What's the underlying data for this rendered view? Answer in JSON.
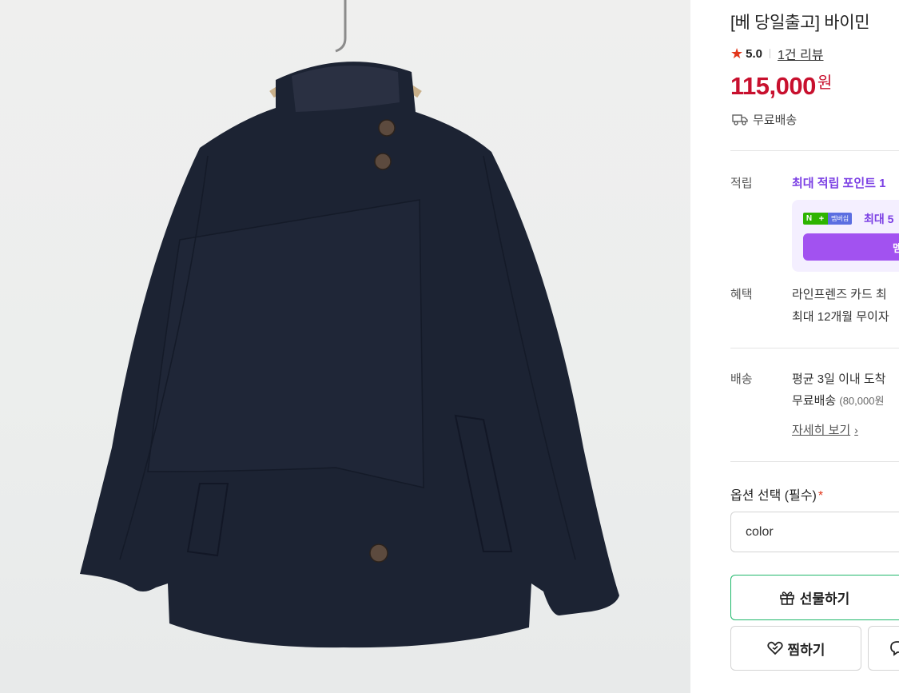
{
  "product": {
    "title": "[베 당일출고] 바이민",
    "rating": "5.0",
    "review_count": "1건 리뷰",
    "price": "115,000",
    "price_unit": "원",
    "shipping_badge": "무료배송",
    "image_alt": "BY MIN"
  },
  "benefits": {
    "points_label": "적립",
    "points_title": "최대 적립 포인트 1",
    "npay_n": "N",
    "npay_plus": "+",
    "npay_membership": "멤버십",
    "points_sub": "최대 5",
    "points_button": "멤버",
    "benefit_label": "혜택",
    "benefit_line1": "라인프렌즈 카드 최",
    "benefit_line2": "최대 12개월 무이자"
  },
  "delivery": {
    "label": "배송",
    "line1": "평균 3일 이내 도착",
    "line2_main": "무료배송",
    "line2_note": "(80,000원",
    "detail_link": "자세히 보기",
    "detail_chevron": "›"
  },
  "options": {
    "label": "옵션 선택 (필수)",
    "required_mark": "*",
    "select_value": "color"
  },
  "actions": {
    "gift": "선물하기",
    "wish": "찜하기"
  },
  "colors": {
    "price": "#c8102e",
    "points": "#7b3fe4",
    "gift_border": "#1fb86b",
    "star": "#e2361b",
    "jacket": "#1c2333"
  }
}
